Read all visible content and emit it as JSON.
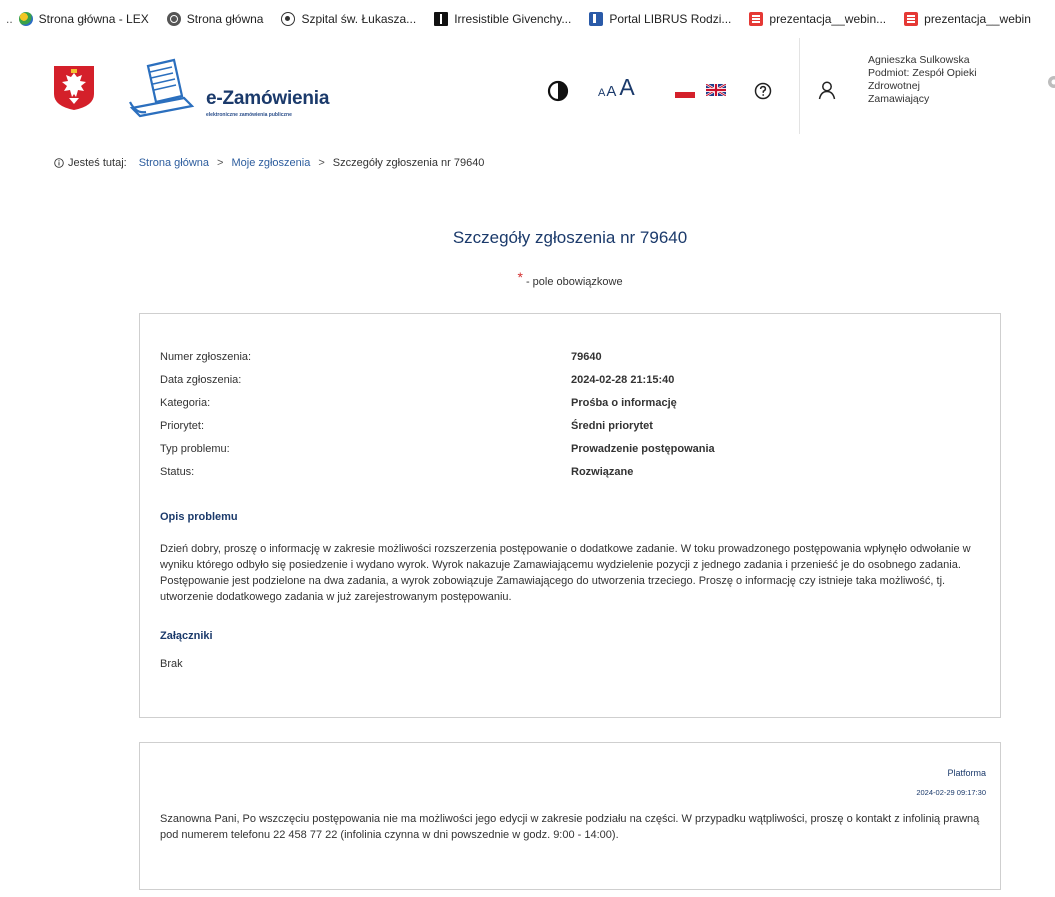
{
  "bookmarks": {
    "leading": "..",
    "items": [
      {
        "label": "Strona główna - LEX",
        "icon": "lex-icon"
      },
      {
        "label": "Strona główna",
        "icon": "globe-icon"
      },
      {
        "label": "Szpital św. Łukasza...",
        "icon": "hospital-icon"
      },
      {
        "label": "Irresistible Givenchy...",
        "icon": "givenchy-icon"
      },
      {
        "label": "Portal LIBRUS Rodzi...",
        "icon": "librus-icon"
      },
      {
        "label": "prezentacja__webin...",
        "icon": "presentation-icon"
      },
      {
        "label": "prezentacja__webin",
        "icon": "presentation-icon"
      }
    ]
  },
  "header": {
    "logo_title": "e-Zamówienia",
    "logo_subtitle": "elektroniczne zamówienia publiczne",
    "font_small": "A",
    "font_mid": "A",
    "font_large": "A",
    "user": {
      "name": "Agnieszka Sulkowska",
      "entity_line1": "Podmiot: Zespół Opieki",
      "entity_line2": "Zdrowotnej",
      "role": "Zamawiający"
    }
  },
  "breadcrumb": {
    "prefix": "Jesteś tutaj:",
    "items": [
      "Strona główna",
      "Moje zgłoszenia",
      "Szczegóły zgłoszenia nr 79640"
    ],
    "separator": ">"
  },
  "page": {
    "title": "Szczegóły zgłoszenia nr 79640",
    "required_star": "*",
    "required_text": " - pole obowiązkowe"
  },
  "details": {
    "fields": [
      {
        "label": "Numer zgłoszenia:",
        "value": "79640"
      },
      {
        "label": "Data zgłoszenia:",
        "value": "2024-02-28 21:15:40"
      },
      {
        "label": "Kategoria:",
        "value": "Prośba o informację"
      },
      {
        "label": "Priorytet:",
        "value": "Średni priorytet"
      },
      {
        "label": "Typ problemu:",
        "value": "Prowadzenie postępowania"
      },
      {
        "label": "Status:",
        "value": "Rozwiązane"
      }
    ],
    "description_heading": "Opis problemu",
    "description": "Dzień dobry, proszę o informację w zakresie możliwości rozszerzenia postępowanie o dodatkowe zadanie. W toku prowadzonego postępowania wpłynęło odwołanie w wyniku którego odbyło się posiedzenie i wydano wyrok. Wyrok nakazuje Zamawiającemu wydzielenie pozycji z jednego zadania i przenieść je do osobnego zadania. Postępowanie jest podzielone na dwa zadania, a wyrok zobowiązuje Zamawiającego do utworzenia trzeciego. Proszę o informację czy istnieje taka możliwość, tj. utworzenie dodatkowego zadania w już zarejestrowanym postępowaniu.",
    "attachments_heading": "Załączniki",
    "attachments_value": "Brak"
  },
  "reply": {
    "author": "Platforma",
    "date": "2024-02-29 09:17:30",
    "text": "Szanowna Pani, Po wszczęciu postępowania nie ma możliwości jego edycji w zakresie podziału na części. W przypadku wątpliwości, proszę o kontakt z infolinią prawną pod numerem telefonu 22 458 77 22 (infolinia czynna w dni powszednie w godz. 9:00 - 14:00)."
  },
  "colors": {
    "brand": "#1b3a6b",
    "link": "#2d5d9e",
    "required": "#d32f2f",
    "card_border": "#cfcfcf"
  }
}
